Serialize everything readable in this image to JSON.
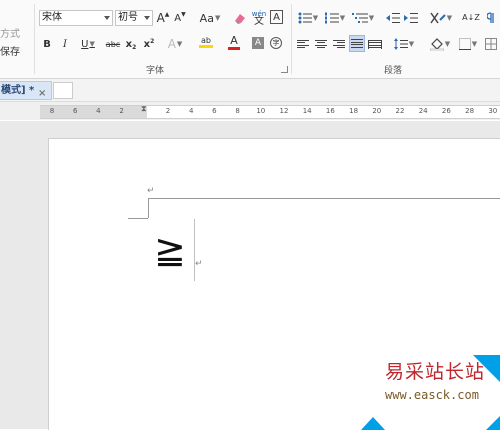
{
  "ribbon": {
    "left_group": {
      "item1": "方式",
      "item2": "保存"
    },
    "font": {
      "family": "宋体",
      "size": "初号",
      "grow_icon": "A",
      "shrink_icon": "A",
      "case_label": "Aa",
      "pinyin_top": "wén",
      "pinyin_bottom": "文",
      "border_char_label": "A",
      "bold_label": "B",
      "italic_label": "I",
      "underline_label": "U",
      "strike_label": "abc",
      "sub_label": "x",
      "sub_suffix": "2",
      "sup_label": "x",
      "sup_suffix": "2",
      "effect_label": "A",
      "highlight_label": "ab",
      "font_color_label": "A",
      "shade_label": "A",
      "enclose_label": "字",
      "group_label": "字体",
      "accent_color": "#ffd700",
      "font_color_bar": "#e02020"
    },
    "paragraph": {
      "group_label": "段落",
      "sort_label": "A↓Z"
    }
  },
  "tabs": {
    "doc_tab_label": "模式] *",
    "close_label": "×"
  },
  "ruler": {
    "ticks": [
      "8",
      "6",
      "4",
      "2",
      "2",
      "4",
      "6",
      "8",
      "10",
      "12",
      "14",
      "16",
      "18",
      "20",
      "22",
      "24",
      "26",
      "28",
      "30"
    ]
  },
  "document": {
    "para_mark_top": "↵",
    "symbol": "≧",
    "para_mark_end": "↵"
  },
  "watermark": {
    "title": "易采站长站",
    "url": "www.easck.com",
    "accent": "#00a0e9"
  }
}
